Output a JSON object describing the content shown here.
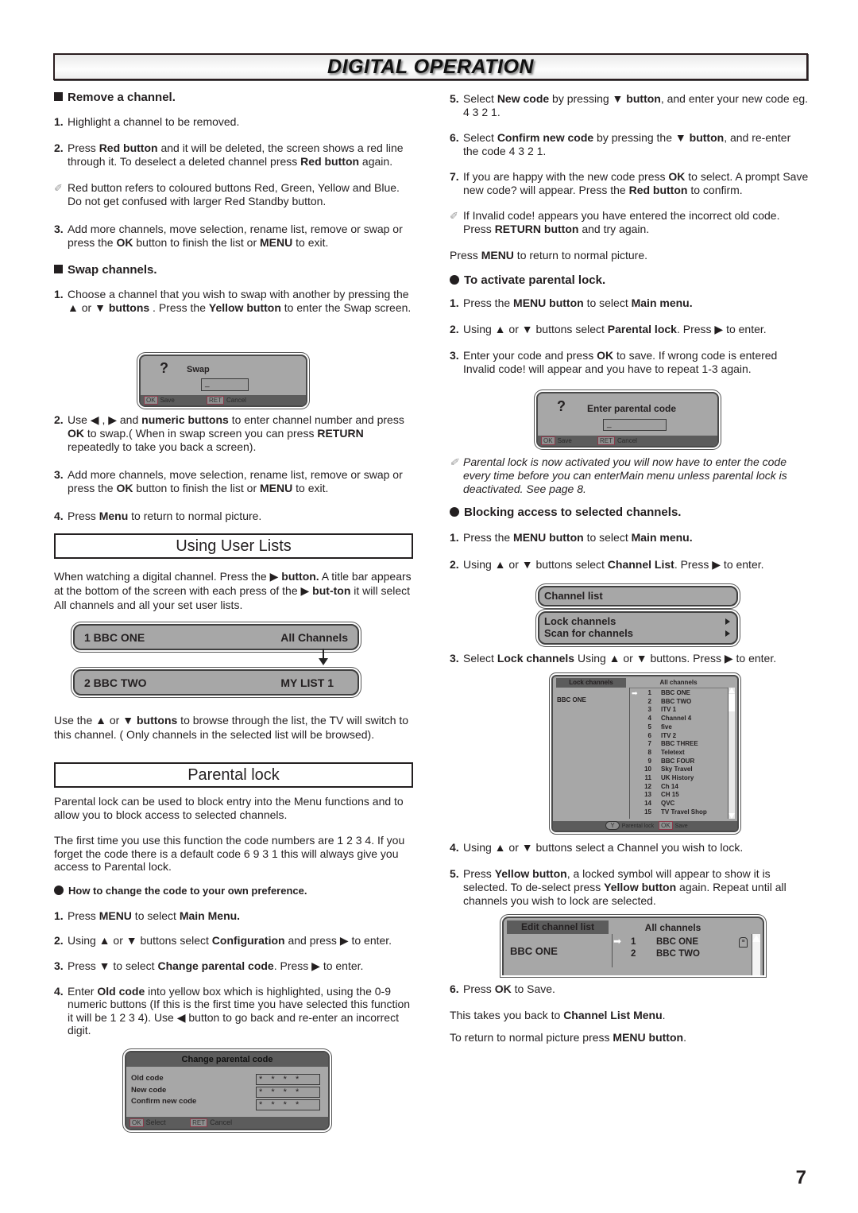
{
  "page": {
    "banner_title": "DIGITAL OPERATION",
    "page_number": "7"
  },
  "remove": {
    "heading": "Remove a channel.",
    "step1": "Highlight a channel to be removed.",
    "step2_a": "Press ",
    "step2_b": "Red button",
    "step2_c": " and it will be deleted, the screen shows a red line through it. To deselect a deleted channel press ",
    "step2_d": "Red button",
    "step2_e": " again.",
    "note": "Red button refers to coloured buttons Red, Green, Yellow and Blue. Do not get confused with larger Red Standby button.",
    "step3_a": "Add more channels, move selection, rename list, remove or swap or press the ",
    "step3_b": "OK",
    "step3_c": " button to finish the list or ",
    "step3_d": "MENU",
    "step3_e": " to exit."
  },
  "swap": {
    "heading": "Swap channels.",
    "step1_a": "Choose a channel that you wish to swap with another by pressing the ▲ or ▼ ",
    "step1_b": "buttons",
    "step1_c": " . Press the ",
    "step1_d": "Yellow button",
    "step1_e": " to enter the Swap screen.",
    "screen": {
      "icon": "?",
      "title": "Swap",
      "input_value": "_",
      "ok_key": "OK",
      "ok_label": "Save",
      "ret_key": "RET",
      "ret_label": "Cancel"
    },
    "step2_a": "Use ◀ , ▶ and ",
    "step2_b": "numeric  buttons",
    "step2_c": " to enter channel number and press ",
    "step2_d": "OK",
    "step2_e": " to swap.( When in swap screen you can press ",
    "step2_f": "RETURN",
    "step2_g": " repeatedly to take you back a screen).",
    "step3_a": "Add more channels, move selection, rename list, remove or swap or press the ",
    "step3_b": "OK",
    "step3_c": " button to finish the list or ",
    "step3_d": "MENU",
    "step3_e": " to exit.",
    "step4_a": "Press ",
    "step4_b": "Menu",
    "step4_c": " to return to normal picture."
  },
  "user_lists": {
    "title": "Using User Lists",
    "intro_a": "When watching a digital channel. Press the ▶ ",
    "intro_b": "button.",
    "intro_c": " A title bar appears at the bottom of the screen with each press of the ▶ ",
    "intro_d": "but-ton",
    "intro_e": " it will select All channels and all your set user lists.",
    "bar1": {
      "channel": "1  BBC ONE",
      "list": "All Channels"
    },
    "bar2": {
      "channel": "2  BBC TWO",
      "list": "MY LIST 1"
    },
    "outro_a": "Use the ▲ or ▼ ",
    "outro_b": "buttons",
    "outro_c": " to browse through the list, the TV will switch to this channel. ( Only channels in the selected list will be browsed)."
  },
  "parental": {
    "title": "Parental lock",
    "intro1": "Parental lock can be used to block entry into the Menu functions and to allow you to block access to selected channels.",
    "intro2": "The first time you use this function the code numbers are 1 2 3 4. If you forget the code there is a default code 6 9 3 1 this will always give you access to Parental lock.",
    "change_heading": "How to change the code to your own preference.",
    "c1_a": "Press ",
    "c1_b": "MENU",
    "c1_c": " to select ",
    "c1_d": "Main Menu.",
    "c2_a": "Using ▲ or ▼ buttons select ",
    "c2_b": "Configuration",
    "c2_c": " and press ▶ to enter.",
    "c3_a": "Press  ▼ to select ",
    "c3_b": "Change parental code",
    "c3_c": ". Press ▶ to enter.",
    "c4_a": "Enter ",
    "c4_b": "Old code",
    "c4_c": " into yellow box which is highlighted, using the 0-9 numeric buttons (If this is the first time you have selected this function it will be 1 2 3 4). Use ◀ button to go back and re-enter an incorrect digit.",
    "code_screen": {
      "title": "Change parental code",
      "rows": [
        {
          "label": "Old code",
          "value": "* * * *"
        },
        {
          "label": "New code",
          "value": "* * * *"
        },
        {
          "label": "Confirm new code",
          "value": "* * * *"
        }
      ],
      "ok_key": "OK",
      "ok_label": "Select",
      "ret_key": "RET",
      "ret_label": "Cancel"
    },
    "c5_a": "Select ",
    "c5_b": "New code",
    "c5_c": " by pressing ▼ ",
    "c5_d": "button",
    "c5_e": ", and enter your new code eg. 4 3 2 1.",
    "c6_a": "Select ",
    "c6_b": "Confirm new code",
    "c6_c": " by pressing the ▼ ",
    "c6_d": "button",
    "c6_e": ", and re-enter the code 4 3 2 1.",
    "c7_a": "If you are happy with the new code press ",
    "c7_b": "OK",
    "c7_c": " to select. A prompt Save new code? will appear. Press the ",
    "c7_d": "Red button",
    "c7_e": " to confirm.",
    "note_a": "If Invalid code! appears you have entered the incorrect old code. Press ",
    "note_b": "RETURN button",
    "note_c": " and try again.",
    "menu_a": "Press ",
    "menu_b": "MENU",
    "menu_c": " to return to normal picture."
  },
  "activate": {
    "heading": "To activate parental lock.",
    "s1_a": "Press the ",
    "s1_b": "MENU button",
    "s1_c": " to select ",
    "s1_d": "Main menu.",
    "s2_a": "Using ▲ or ▼ buttons select ",
    "s2_b": "Parental lock",
    "s2_c": ". Press  ▶  to enter.",
    "s3_a": "Enter your code and press ",
    "s3_b": "OK",
    "s3_c": " to save. If wrong code is entered Invalid code! will appear and you have to repeat 1-3 again.",
    "screen": {
      "icon": "?",
      "title": "Enter parental code",
      "input_value": "_",
      "ok_key": "OK",
      "ok_label": "Save",
      "ret_key": "RET",
      "ret_label": "Cancel"
    },
    "note": "Parental lock is now activated you will now have to enter the code every time before you can enterMain menu unless parental lock is deactivated. See page 8."
  },
  "blocking": {
    "heading": "Blocking access to selected channels.",
    "s1_a": "Press the ",
    "s1_b": "MENU button",
    "s1_c": " to select ",
    "s1_d": "Main menu.",
    "s2_a": "Using ▲ or ▼ buttons select ",
    "s2_b": "Channel List",
    "s2_c": ". Press  ▶  to enter.",
    "menu_title": "Channel list",
    "menu_items": [
      "Lock channels",
      "Scan for channels"
    ],
    "s3_a": "Select ",
    "s3_b": "Lock channels",
    "s3_c": " Using ▲ or ▼ buttons. Press  ▶  to enter.",
    "lock_screen": {
      "left_tab": "Lock channels",
      "right_tab": "All channels",
      "current": "BBC ONE",
      "channels": [
        {
          "num": "1",
          "name": "BBC ONE"
        },
        {
          "num": "2",
          "name": "BBC TWO"
        },
        {
          "num": "3",
          "name": "ITV 1"
        },
        {
          "num": "4",
          "name": "Channel 4"
        },
        {
          "num": "5",
          "name": "five"
        },
        {
          "num": "6",
          "name": "ITV 2"
        },
        {
          "num": "7",
          "name": "BBC THREE"
        },
        {
          "num": "8",
          "name": "Teletext"
        },
        {
          "num": "9",
          "name": "BBC FOUR"
        },
        {
          "num": "10",
          "name": "Sky Travel"
        },
        {
          "num": "11",
          "name": "UK History"
        },
        {
          "num": "12",
          "name": "Ch 14"
        },
        {
          "num": "13",
          "name": "CH 15"
        },
        {
          "num": "14",
          "name": "QVC"
        },
        {
          "num": "15",
          "name": "TV Travel Shop"
        }
      ],
      "y_key": "Y",
      "y_label": "Parental lock",
      "ok_key": "OK",
      "ok_label": "Save"
    },
    "s4": "Using ▲ or ▼ buttons select a Channel you wish to lock.",
    "s5_a": "Press ",
    "s5_b": "Yellow button",
    "s5_c": ", a locked symbol will appear  to show it is selected. To  de-select press ",
    "s5_d": "Yellow button",
    "s5_e": " again. Repeat until all channels you wish to lock are selected.",
    "edit_screen": {
      "left_tab": "Edit channel list",
      "right_tab": "All channels",
      "current": "BBC ONE",
      "channels": [
        {
          "num": "1",
          "name": "BBC ONE"
        },
        {
          "num": "2",
          "name": "BBC TWO"
        }
      ]
    },
    "s6_a": "Press ",
    "s6_b": "OK",
    "s6_c": " to Save.",
    "back_a": "This takes you back to ",
    "back_b": "Channel List Menu",
    "back_c": ".",
    "ret_a": "To return to normal picture press ",
    "ret_b": "MENU button",
    "ret_c": "."
  }
}
